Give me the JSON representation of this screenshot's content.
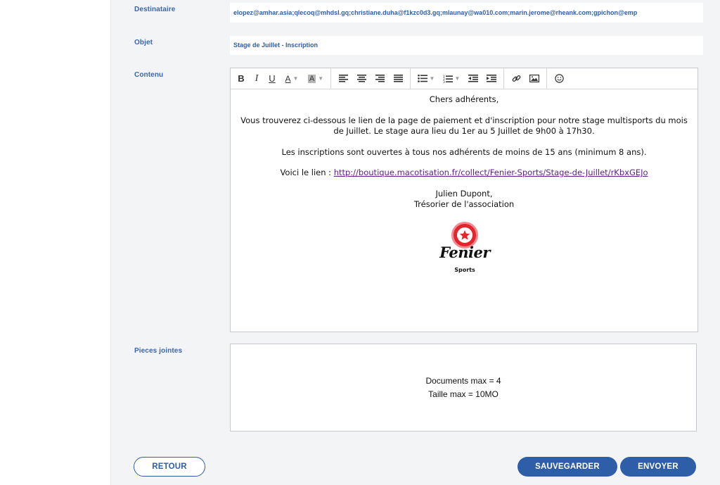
{
  "form": {
    "recipient_label": "Destinataire",
    "recipient_value": "elopez@amhar.asia;qlecoq@mhdsl.gq;christiane.duha@f1kzc0d3.gq;mlaunay@wa010.com;marin.jerome@rheank.com;gpichon@emp",
    "subject_label": "Objet",
    "subject_value": "Stage de Juillet - Inscription",
    "content_label": "Contenu",
    "attachments_label": "Pieces jointes"
  },
  "editor": {
    "toolbar": {
      "bold": "B",
      "italic": "I",
      "underline": "U",
      "text_color": "A",
      "highlight": "A"
    },
    "body": {
      "greeting": "Chers adhérents,",
      "paragraph1": "Vous trouverez ci-dessous le lien de la page de paiement et d'inscription pour notre stage multisports du mois de Juillet. Le stage aura lieu du 1er au 5 Juillet de 9h00 à 17h30.",
      "paragraph2": "Les inscriptions sont ouvertes à tous nos adhérents de moins de 15 ans (minimum 8 ans).",
      "link_prefix": "Voici le lien : ",
      "link_url": "http://boutique.macotisation.fr/collect/Fenier-Sports/Stage-de-Juillet/rKbxGEJo",
      "signature_name": "Julien Dupont,",
      "signature_role": "Trésorier de l'association",
      "logo_name": "Fenier",
      "logo_sub": "Sports"
    }
  },
  "attachments": {
    "max_documents": "Documents max = 4",
    "max_size": "Taille max = 10MO"
  },
  "buttons": {
    "back": "RETOUR",
    "save": "SAUVEGARDER",
    "send": "ENVOYER"
  },
  "colors": {
    "accent": "#2f5ea8",
    "label": "#3a66b0",
    "logo_red": "#e3262d",
    "link": "#5a1f8a"
  }
}
